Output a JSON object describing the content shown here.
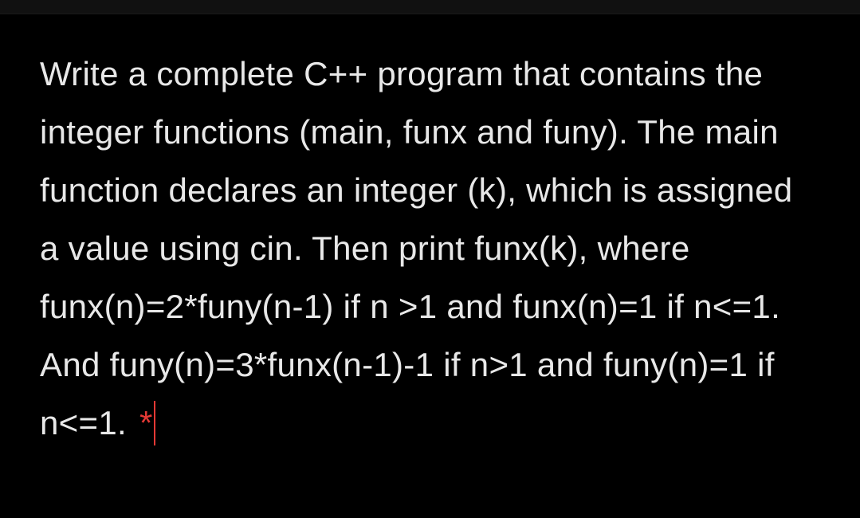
{
  "question": {
    "text": "Write a complete C++ program that contains the integer functions (main, funx and funy). The main function declares an integer (k), which is assigned a value using cin. Then print funx(k), where funx(n)=2*funy(n-1) if n >1 and funx(n)=1 if n<=1. And funy(n)=3*funx(n-1)-1 if n>1 and funy(n)=1 if n<=1.",
    "required_marker": "*"
  }
}
